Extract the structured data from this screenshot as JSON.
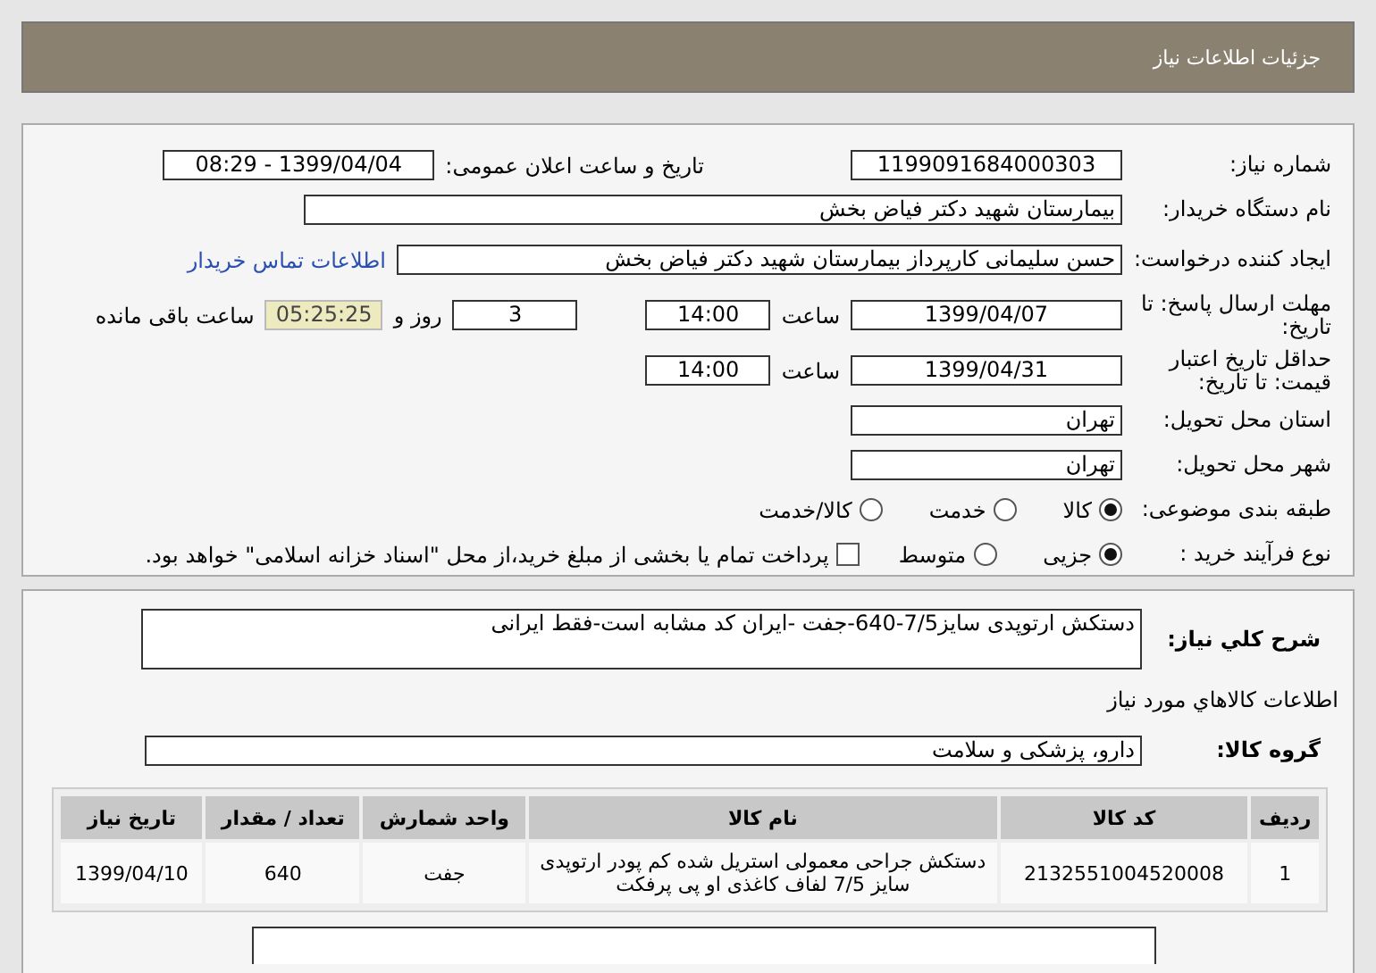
{
  "header": {
    "title": "جزئیات اطلاعات نیاز"
  },
  "need_number": {
    "label": "شماره نیاز:",
    "value": "1199091684000303"
  },
  "announce": {
    "label": "تاریخ و ساعت اعلان عمومی:",
    "value": "1399/04/04 - 08:29"
  },
  "buyer": {
    "label": "نام دستگاه خریدار:",
    "value": "بیمارستان شهید دکتر فیاض بخش"
  },
  "creator": {
    "label": "ایجاد کننده درخواست:",
    "value": "حسن سلیمانی کارپرداز بیمارستان شهید دکتر فیاض بخش",
    "link": "اطلاعات تماس خریدار"
  },
  "deadline": {
    "label": "مهلت ارسال پاسخ: تا تاریخ:",
    "date": "1399/04/07",
    "time_label": "ساعت",
    "time": "14:00",
    "days": "3",
    "days_label": "روز و",
    "remaining": "05:25:25",
    "remaining_label": "ساعت باقی مانده"
  },
  "validity": {
    "label": "حداقل تاریخ اعتبار قیمت: تا تاریخ:",
    "date": "1399/04/31",
    "time_label": "ساعت",
    "time": "14:00"
  },
  "province": {
    "label": "استان محل تحویل:",
    "value": "تهران"
  },
  "city": {
    "label": "شهر محل تحویل:",
    "value": "تهران"
  },
  "category": {
    "label": "طبقه بندی موضوعی:",
    "options": [
      {
        "label": "کالا",
        "selected": true
      },
      {
        "label": "خدمت",
        "selected": false
      },
      {
        "label": "کالا/خدمت",
        "selected": false
      }
    ]
  },
  "process": {
    "label": "نوع فرآیند خرید :",
    "options": [
      {
        "label": "جزیی",
        "selected": true
      },
      {
        "label": "متوسط",
        "selected": false
      }
    ],
    "payment": {
      "label": "پرداخت تمام یا بخشی از مبلغ خرید،از محل \"اسناد خزانه اسلامی\" خواهد بود.",
      "checked": false
    }
  },
  "description": {
    "label": "شرح کلي نياز:",
    "value": "دستکش ارتوپدی سایز7/5-640-جفت -ایران کد مشابه است-فقط ایرانی"
  },
  "goods_title": "اطلاعات کالاهاي مورد نياز",
  "group": {
    "label": "گروه کالا:",
    "value": "دارو، پزشکی و سلامت"
  },
  "table": {
    "columns": [
      "ردیف",
      "کد کالا",
      "نام کالا",
      "واحد شمارش",
      "تعداد / مقدار",
      "تاریخ نیاز"
    ],
    "rows": [
      [
        "1",
        "2132551004520008",
        "دستکش جراحی معمولی استریل شده کم پودر ارتوپدی سایز 7/5 لفاف کاغذی او پی پرفکت",
        "جفت",
        "640",
        "1399/04/10"
      ]
    ]
  }
}
